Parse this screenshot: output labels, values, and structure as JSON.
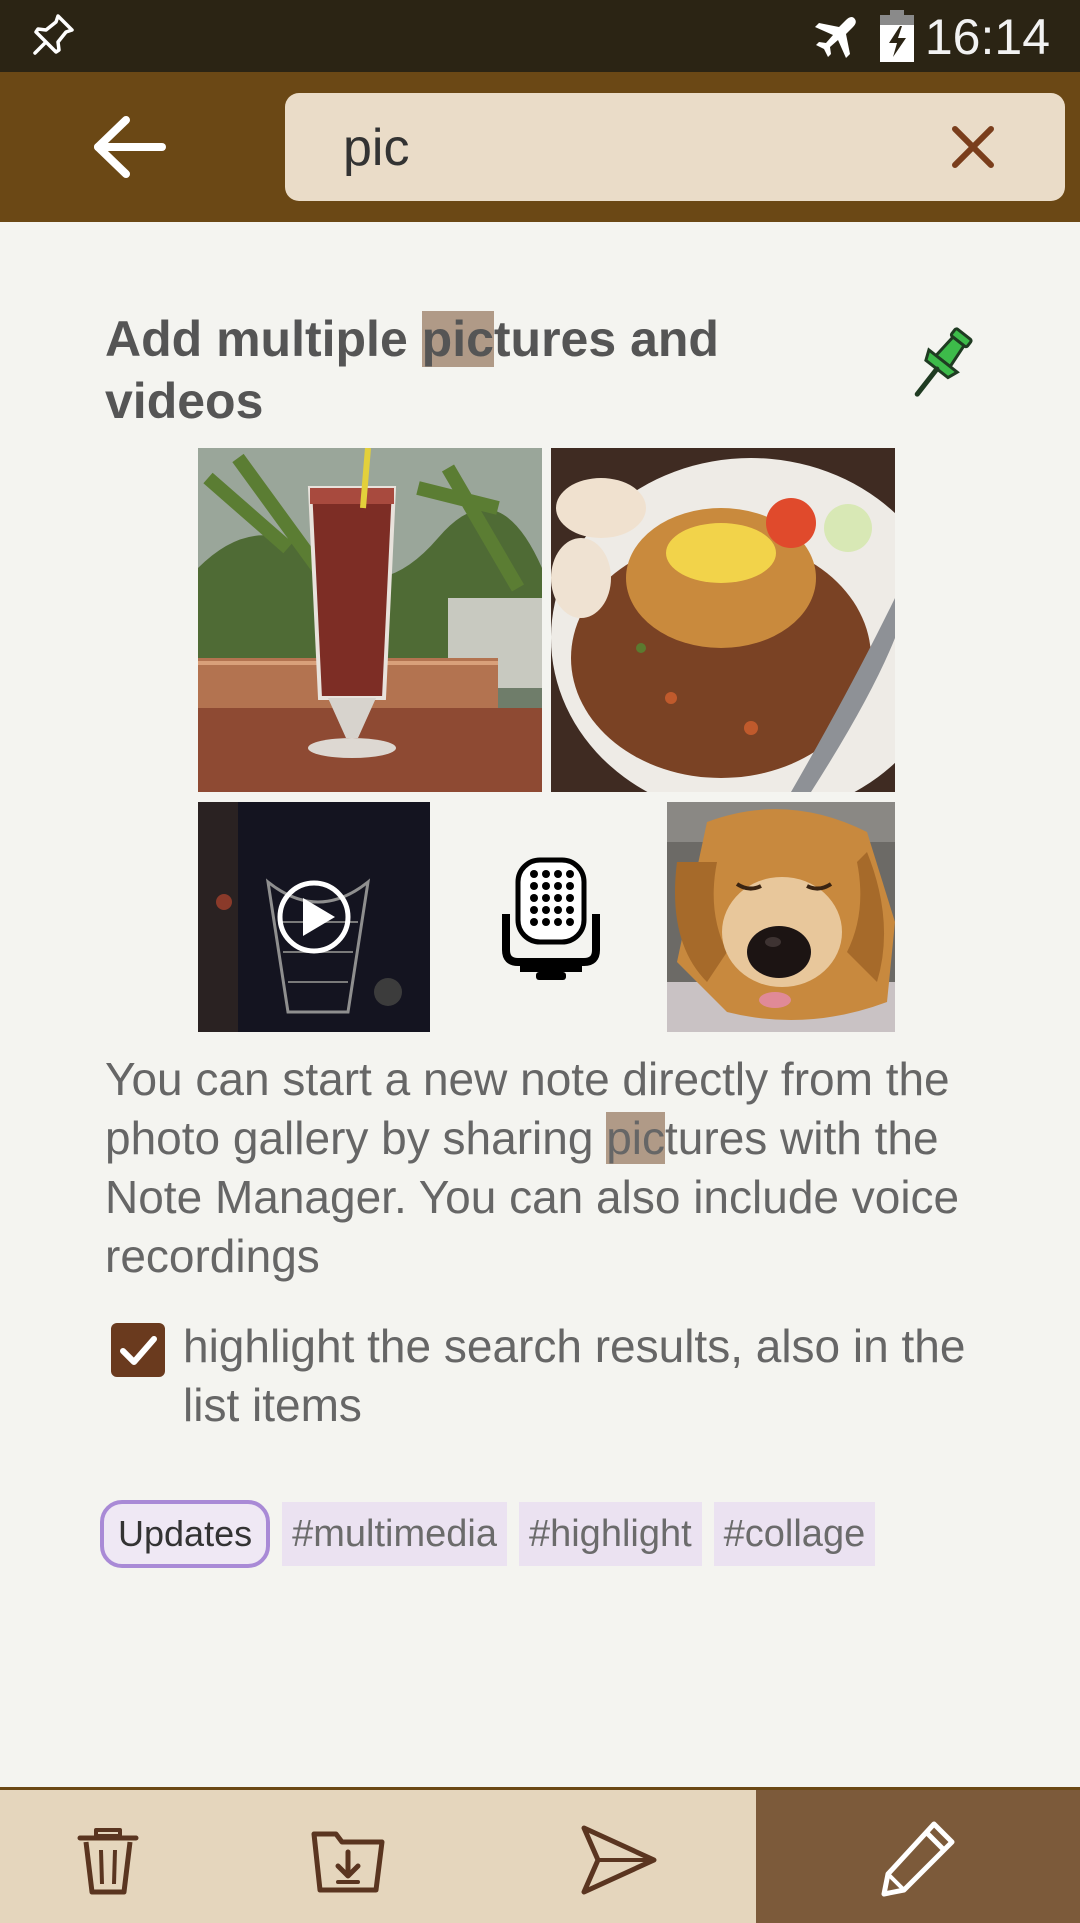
{
  "status_bar": {
    "time": "16:14",
    "icons": [
      "pin-icon",
      "airplane-mode-icon",
      "battery-charging-icon"
    ]
  },
  "toolbar": {
    "back_icon": "arrow-left-icon",
    "search": {
      "value": "pic",
      "clear_icon": "close-icon"
    }
  },
  "note": {
    "title_match": "pic",
    "title_before": "Add multiple ",
    "title_after": "tures and videos",
    "pin_icon": "pushpin-icon",
    "pin_color": "#3dbb4a",
    "attachments": [
      {
        "kind": "image",
        "icon": "drink-photo"
      },
      {
        "kind": "image",
        "icon": "food-photo"
      },
      {
        "kind": "video",
        "icon": "play-icon"
      },
      {
        "kind": "audio",
        "icon": "microphone-icon"
      },
      {
        "kind": "image",
        "icon": "dog-photo"
      }
    ],
    "body_before": "You can start a new note directly from the photo gallery by sharing ",
    "body_match": "pic",
    "body_after": "tures with the Note Manager. You can also include voice recordings",
    "checklist_item": {
      "checked": true,
      "label": "highlight the search results, also in the list items"
    },
    "category": "Updates",
    "tags": [
      "#multimedia",
      "#highlight",
      "#collage"
    ]
  },
  "bottom_bar": {
    "actions": [
      "trash-icon",
      "folder-download-icon",
      "send-icon",
      "pencil-icon"
    ]
  },
  "colors": {
    "status_bar": "#2b2414",
    "toolbar": "#6b4815",
    "search_field": "#eadcc8",
    "highlight": "#b09a87",
    "checkbox": "#6a3a1e",
    "category_border": "#a98ad6",
    "tag_background": "#ebe2f1",
    "bottom_bar": "#e5d6bd",
    "edit_button": "#7c5a3a"
  }
}
